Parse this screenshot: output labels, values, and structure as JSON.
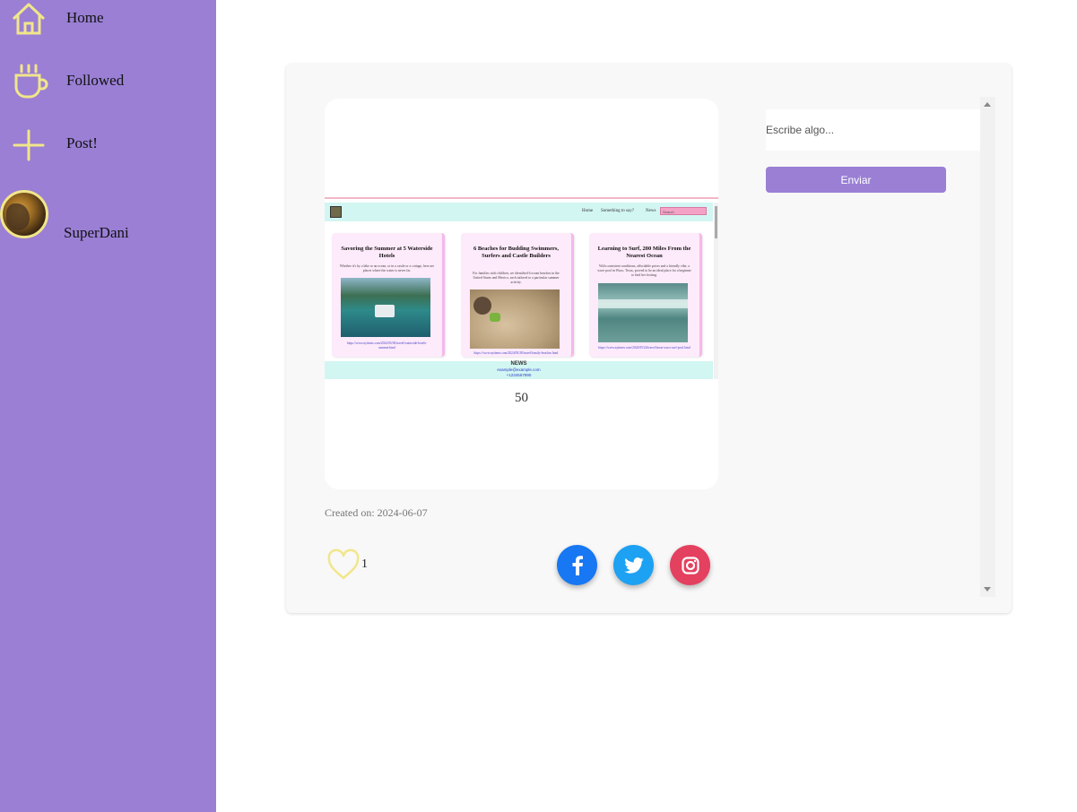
{
  "sidebar": {
    "items": [
      {
        "label": "Home",
        "icon": "home-icon"
      },
      {
        "label": "Followed",
        "icon": "coffee-cup-icon"
      },
      {
        "label": "Post!",
        "icon": "plus-icon"
      }
    ],
    "user": {
      "name": "SuperDani"
    },
    "colors": {
      "background": "#9a7fd5",
      "icon": "#f1e68a"
    }
  },
  "post": {
    "preview": {
      "nav": {
        "home": "Home",
        "say": "Something to say?",
        "news": "News",
        "search_placeholder": "Search"
      },
      "articles": [
        {
          "title": "Savoring the Summer at 5 Waterside Hotels",
          "desc": "Whether it's by a lake or an ocean, or in a castle or a cottage, here are places where the water is never far.",
          "link": "https://www.nytimes.com/2024/05/30/travel/waterside-hotels-summer.html"
        },
        {
          "title": "6 Beaches for Budding Swimmers, Surfers and Castle Builders",
          "desc": "For families with children, we identified 6 ocean beaches in the United States and Mexico, each tailored to a particular summer activity.",
          "link": "https://www.nytimes.com/2024/05/28/travel/family-beaches.html"
        },
        {
          "title": "Learning to Surf, 200 Miles From the Nearest Ocean",
          "desc": "With consistent conditions, affordable prices and a friendly vibe, a wave pool in Waco, Texas, proved to be an ideal place for a beginner to find her footing.",
          "link": "https://www.nytimes.com/2024/05/24/travel/texas-waco-surf-pool.html"
        }
      ],
      "footer": {
        "brand": "NEWS",
        "email": "example@example.com",
        "phone": "+1234567890"
      }
    },
    "count": "50",
    "created": "Created on: 2024-06-07",
    "likes": "1"
  },
  "social": {
    "facebook": {
      "icon": "facebook-icon",
      "color": "#1877f2"
    },
    "twitter": {
      "icon": "twitter-icon",
      "color": "#1da1f2"
    },
    "instagram": {
      "icon": "instagram-icon",
      "color": "#e4405f"
    }
  },
  "comment": {
    "placeholder": "Escribe algo...",
    "send_label": "Enviar"
  }
}
